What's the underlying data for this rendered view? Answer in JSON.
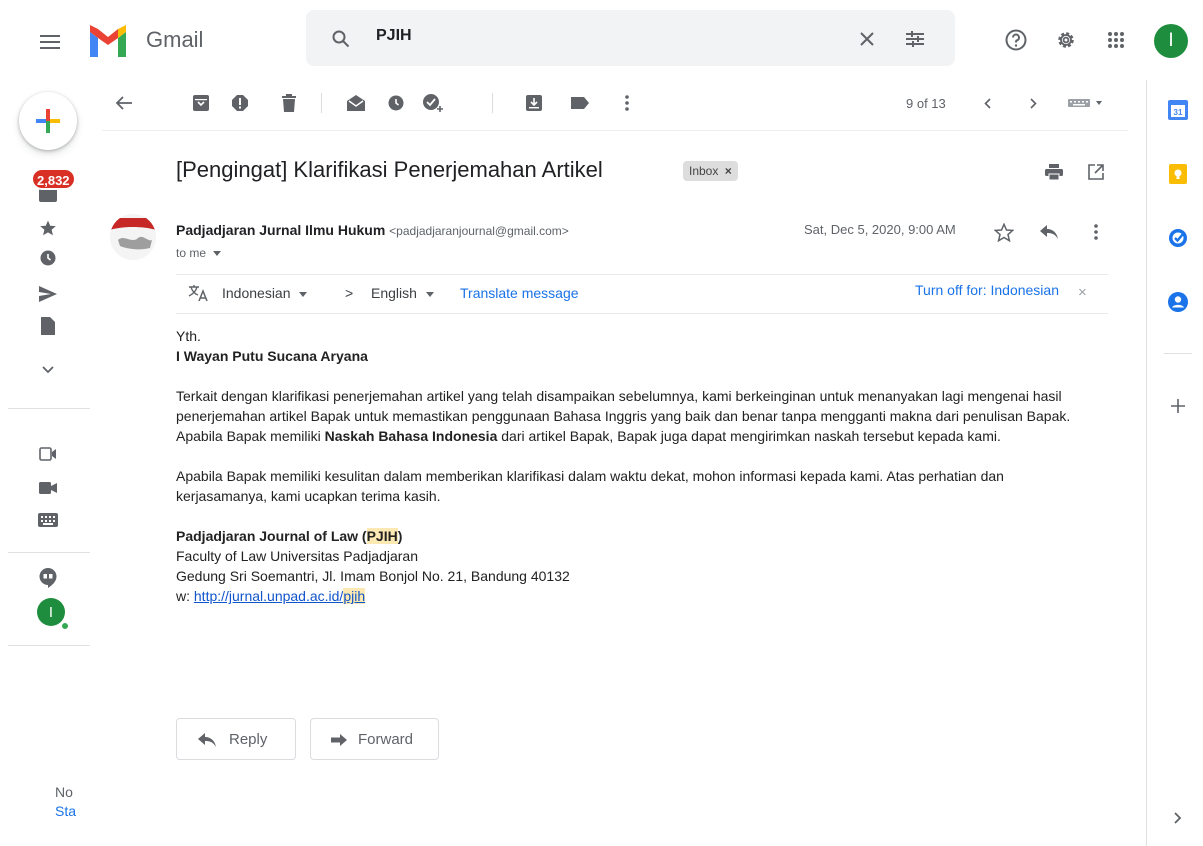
{
  "app": {
    "name": "Gmail"
  },
  "search": {
    "query": "PJIH"
  },
  "user": {
    "initial": "I"
  },
  "nav": {
    "unread_badge": "2,832",
    "footer_line1": "No",
    "footer_line2": "Sta"
  },
  "toolbar": {
    "pager": "9 of 13"
  },
  "message": {
    "subject": "[Pengingat] Klarifikasi Penerjemahan Artikel",
    "label": "Inbox",
    "label_close": "×",
    "sender_name": "Padjadjaran Jurnal Ilmu Hukum",
    "sender_email": "<padjadjaranjournal@gmail.com>",
    "to": "to me",
    "date": "Sat, Dec 5, 2020, 9:00 AM"
  },
  "translate": {
    "source_lang": "Indonesian",
    "separator": ">",
    "target_lang": "English",
    "action": "Translate message",
    "turn_off": "Turn off for: Indonesian",
    "close": "×"
  },
  "body": {
    "greeting": "Yth.",
    "recipient": "I Wayan Putu Sucana Aryana",
    "p1_before": "Terkait dengan klarifikasi penerjemahan artikel yang telah disampaikan sebelumnya, kami berkeinginan untuk menanyakan lagi mengenai hasil penerjemahan artikel Bapak untuk memastikan penggunaan Bahasa Inggris yang baik dan benar tanpa mengganti makna dari penulisan Bapak. Apabila Bapak memiliki ",
    "p1_bold": "Naskah Bahasa Indonesia",
    "p1_after": " dari artikel Bapak, Bapak juga dapat mengirimkan naskah tersebut kepada kami.",
    "p2": "Apabila Bapak memiliki kesulitan dalam memberikan klarifikasi dalam waktu dekat, mohon informasi kepada kami. Atas perhatian dan kerjasamanya, kami ucapkan terima kasih.",
    "sig_name_before": "Padjadjaran Journal of Law (",
    "sig_name_hl": "PJIH",
    "sig_name_after": ")",
    "sig_line2": "Faculty of Law Universitas Padjadjaran",
    "sig_line3": "Gedung Sri Soemantri, Jl. Imam Bonjol No. 21, Bandung 40132",
    "sig_web_prefix": "w: ",
    "sig_link_text": "http://jurnal.unpad.ac.id/",
    "sig_link_hl": "pjih"
  },
  "actions": {
    "reply": "Reply",
    "forward": "Forward"
  },
  "colors": {
    "accent": "#1a73e8",
    "badge": "#d93025",
    "avatar": "#1e8e3e",
    "highlight": "#fce8b2"
  }
}
